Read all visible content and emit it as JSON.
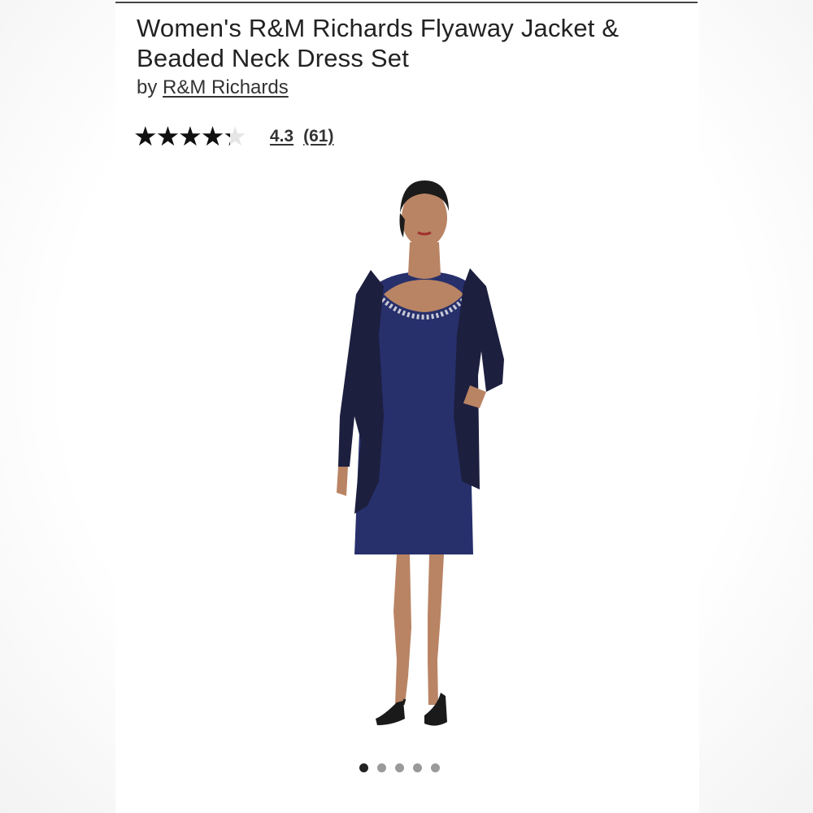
{
  "product": {
    "title": "Women's R&M Richards Flyaway Jacket & Beaded Neck Dress Set",
    "by_prefix": "by",
    "brand": "R&M Richards",
    "rating": {
      "stars": "★★★★★",
      "value": "4.3",
      "count": "(61)",
      "fraction": 0.86
    },
    "image": {
      "description_icon": "product-photo",
      "colors": {
        "jacket": "#1d1f3f",
        "dress": "#27306b",
        "skin": "#b98464"
      }
    },
    "carousel": {
      "total": 5,
      "active": 1
    }
  }
}
